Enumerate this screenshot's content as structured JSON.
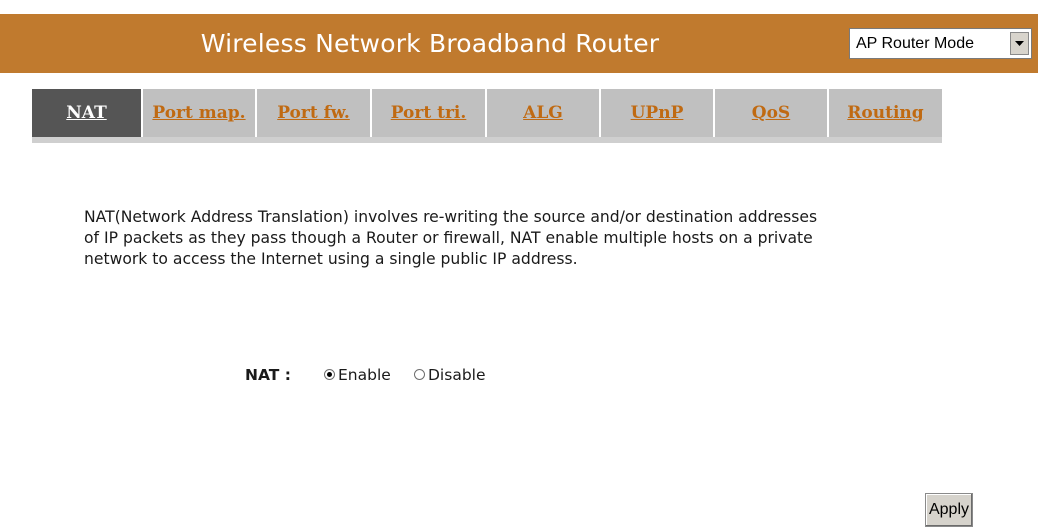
{
  "header": {
    "title": "Wireless Network Broadband Router",
    "background_color": "#c07a2e"
  },
  "mode_select": {
    "value": "AP Router Mode",
    "arrow_icon": "chevron-down-icon"
  },
  "tabs": [
    {
      "label": "NAT",
      "active": true
    },
    {
      "label": "Port map.",
      "active": false
    },
    {
      "label": "Port fw.",
      "active": false
    },
    {
      "label": "Port tri.",
      "active": false
    },
    {
      "label": "ALG",
      "active": false
    },
    {
      "label": "UPnP",
      "active": false
    },
    {
      "label": "QoS",
      "active": false
    },
    {
      "label": "Routing",
      "active": false
    }
  ],
  "tab_colors": {
    "active_bg": "#555555",
    "inactive_bg": "#c0c0c0",
    "inactive_text": "#c06a12"
  },
  "description": {
    "line1": "NAT(Network Address Translation) involves re-writing the source and/or destination addresses",
    "line2": "of IP packets as they pass though a Router or firewall, NAT enable multiple hosts on a private",
    "line3": "network to access the Internet using a single public IP address."
  },
  "nat_setting": {
    "label": "NAT :",
    "options": [
      {
        "label": "Enable",
        "checked": true
      },
      {
        "label": "Disable",
        "checked": false
      }
    ]
  },
  "apply_label": "Apply"
}
